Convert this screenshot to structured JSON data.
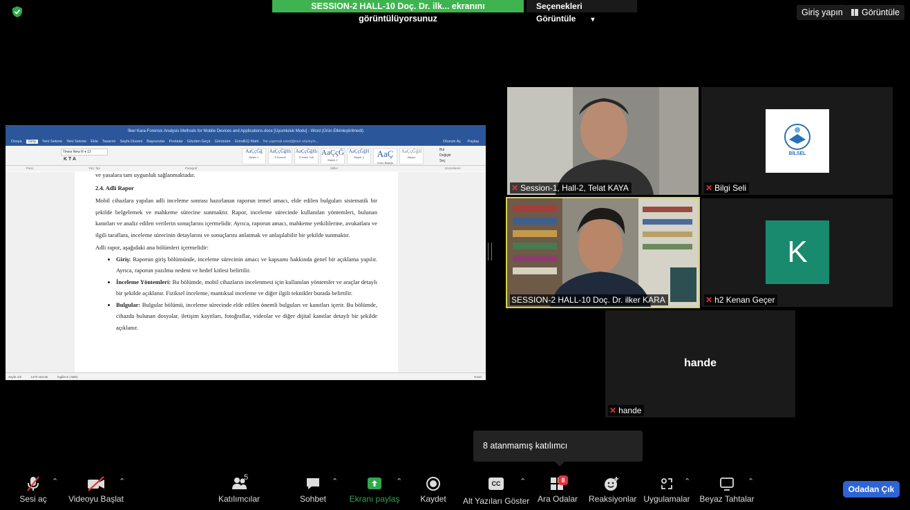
{
  "top_bar": {
    "share_banner": "SESSION-2 HALL-10 Doç. Dr. ilk... ekranını görüntülüyorsunuz",
    "view_options": "Seçenekleri Görüntüle",
    "login": "Giriş yapın",
    "view": "Görüntüle"
  },
  "word": {
    "title": "İlker Kara-Forensic Analysis Methods for Mobile Devices and Applications.docx [Uyumluluk Modu] - Word (Ürün Etkinleştirilmedi)",
    "menu": [
      "Dosya",
      "Giriş",
      "Yeni Sekme",
      "Yeni Sekme",
      "Ekle",
      "Tasarım",
      "Sayfa Düzeni",
      "Başvurular",
      "Postalar",
      "Gözden Geçir",
      "Görünüm",
      "GrindEQ Math",
      "Ne yapmak istediğinizi söyleyin..."
    ],
    "account": [
      "Oturum Aç",
      "Paylaş"
    ],
    "font_name": "Times New R",
    "font_size": "12",
    "styles": [
      {
        "sample": "AaÇçĞğ",
        "name": "Başlık 1"
      },
      {
        "sample": "AaÇçĞğHı",
        "name": "¶ Normal"
      },
      {
        "sample": "AaÇçĞğHı",
        "name": "¶ Aralık Yok"
      },
      {
        "sample": "AaÇçĞ",
        "name": "Başlık 2"
      },
      {
        "sample": "AaÇçĞğH",
        "name": "Başlık 3"
      },
      {
        "sample": "AaÇ",
        "name": "Konu Başlığı"
      },
      {
        "sample": "AaÇçĞğH",
        "name": "Altyazı"
      }
    ],
    "edit": [
      "Bul",
      "Değiştir",
      "Seç"
    ],
    "ribbon_groups": [
      "Pano",
      "Yazı Tipi",
      "Paragraf",
      "Stiller",
      "Düzenleme"
    ],
    "para0": "ve yasalara tam uygunluk sağlanmaktadır.",
    "heading": "2.4. Adli Rapor",
    "para1": "Mobil cihazlara yapılan adli inceleme sonrası hazırlanan raporun temel amacı, elde edilen bulguları sistematik bir şekilde belgelemek ve mahkeme sürecine sunmaktır. Rapor, inceleme sürecinde kullanılan yöntemleri, bulunan kanıtları ve analiz edilen verilerin sonuçlarını içermelidir. Ayrıca, raporun amacı, mahkeme yetkililerine, avukatlara ve ilgili taraflara, inceleme sürecinin detaylarını ve sonuçlarını anlatmak ve anlaşılabilir bir şekilde sunmaktır.",
    "para2": "Adli rapor, aşağıdaki ana bölümleri içermelidir:",
    "bullets": [
      {
        "bold": "Giriş:",
        "text": " Raporun giriş bölümünde, inceleme sürecinin amacı ve kapsamı hakkında genel bir açıklama yapılır. Ayrıca, raporun yazılma nedeni ve hedef kitlesi belirtilir."
      },
      {
        "bold": "İnceleme Yöntemleri:",
        "text": " Bu bölümde, mobil cihazların incelenmesi için kullanılan yöntemler ve araçlar detaylı bir şekilde açıklanır. Fiziksel inceleme, mantıksal inceleme ve diğer ilgili teknikler burada belirtilir."
      },
      {
        "bold": "Bulgular:",
        "text": " Bulgular bölümü, inceleme sürecinde elde edilen önemli bulguları ve kanıtları içerir. Bu bölümde, cihazda bulunan dosyalar, iletişim kayıtları, fotoğraflar, videolar ve diğer dijital kanıtlar detaylı bir şekilde açıklanır."
      }
    ],
    "status_page": "Sayfa 1/6",
    "status_words": "1473 sözcük",
    "status_lang": "İngilizce (ABD)",
    "zoom": "%110"
  },
  "tiles": {
    "t1": "Session-1, Hall-2, Telat KAYA",
    "t2": "Bilgi Seli",
    "t3": "SESSION-2 HALL-10 Doç. Dr. ilker KARA",
    "t4": "h2 Kenan Geçer",
    "t4_avatar": "K",
    "t5": "hande",
    "t5_center": "hande",
    "logo_text": "BİLSEL"
  },
  "tooltip": "8 atanmamış katılımcı",
  "toolbar": {
    "mute": "Sesi aç",
    "video": "Videoyu Başlat",
    "participants": "Katılımcılar",
    "participants_count": "5",
    "chat": "Sohbet",
    "share": "Ekranı paylaş",
    "record": "Kaydet",
    "captions": "Alt Yazıları Göster",
    "captions_icon": "CC",
    "breakout": "Ara Odalar",
    "breakout_badge": "8",
    "reactions": "Reaksiyonlar",
    "apps": "Uygulamalar",
    "whiteboard": "Beyaz Tahtalar",
    "leave": "Odadan Çık"
  },
  "colors": {
    "share_green": "#3fb34f",
    "leave_blue": "#2d64d6",
    "active_border": "#d6d44a",
    "mute_red": "#e0392f"
  }
}
